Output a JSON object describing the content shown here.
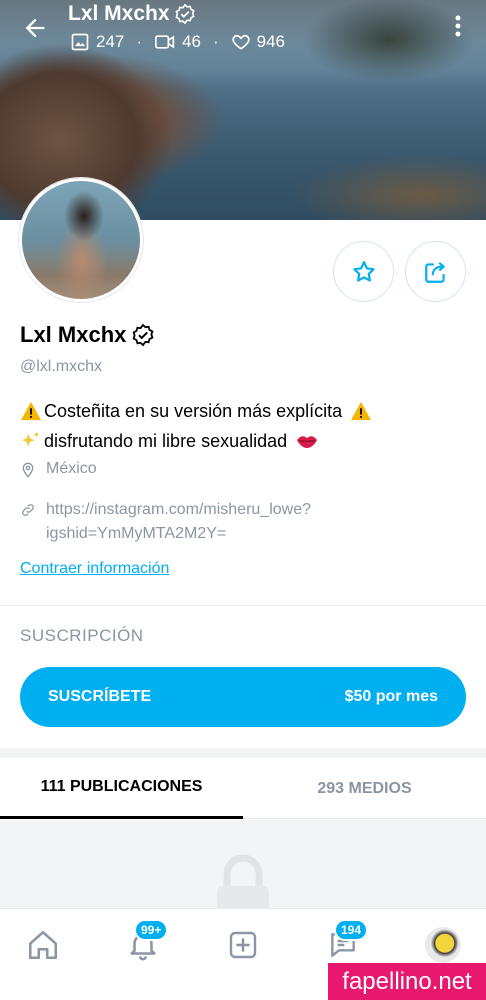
{
  "header": {
    "title": "Lxl Mxchx",
    "stats": {
      "photos": "247",
      "videos": "46",
      "likes": "946"
    }
  },
  "profile": {
    "name": "Lxl Mxchx",
    "handle": "@lxl.mxchx",
    "bio_line1": "Costeñita en su versión más explícita",
    "bio_line2": "disfrutando mi libre sexualidad",
    "location": "México",
    "link_line1": "https://instagram.com/misheru_lowe?",
    "link_line2": "igshid=YmMyMTA2M2Y=",
    "collapse_label": "Contraer información"
  },
  "subscription": {
    "header": "SUSCRIPCIÓN",
    "button_label": "SUSCRÍBETE",
    "price": "$50 por mes"
  },
  "tabs": [
    {
      "label": "111 PUBLICACIONES"
    },
    {
      "label": "293 MEDIOS"
    }
  ],
  "bottom_nav": {
    "notifications_badge": "99+",
    "messages_badge": "194"
  },
  "watermark": "fapellino.net",
  "colors": {
    "accent": "#00aff0",
    "muted": "#8a96a3",
    "watermark": "#e8186e"
  },
  "icons": [
    "back-arrow-icon",
    "more-vert-icon",
    "image-icon",
    "video-icon",
    "heart-icon",
    "verified-icon",
    "star-icon",
    "share-icon",
    "location-icon",
    "link-icon",
    "lock-icon",
    "home-icon",
    "bell-icon",
    "add-square-icon",
    "chat-icon"
  ]
}
